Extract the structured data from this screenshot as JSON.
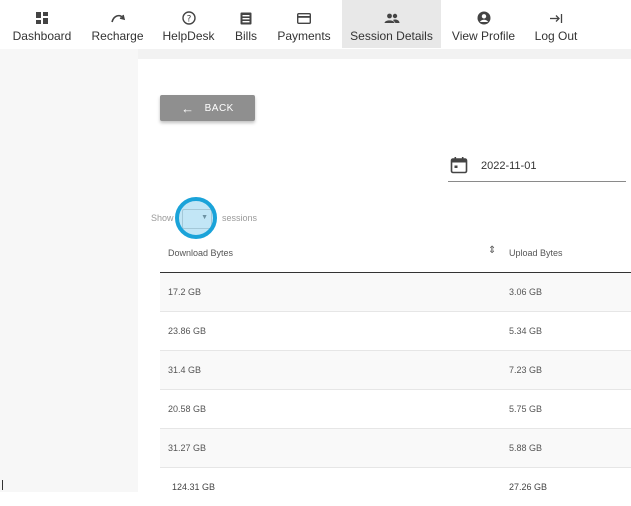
{
  "nav": {
    "items": [
      {
        "label": "Dashboard",
        "icon": "dashboard-icon"
      },
      {
        "label": "Recharge",
        "icon": "recharge-icon"
      },
      {
        "label": "HelpDesk",
        "icon": "help-icon"
      },
      {
        "label": "Bills",
        "icon": "bills-icon"
      },
      {
        "label": "Payments",
        "icon": "payments-icon"
      },
      {
        "label": "Session Details",
        "icon": "people-icon",
        "active": true
      },
      {
        "label": "View Profile",
        "icon": "profile-icon"
      },
      {
        "label": "Log Out",
        "icon": "logout-icon"
      }
    ]
  },
  "back_button": {
    "label": "BACK",
    "icon": "arrow-left-icon"
  },
  "date_filter": {
    "value": "2022-11-01",
    "icon": "calendar-icon"
  },
  "length_control": {
    "show_label": "Show",
    "suffix_label": "sessions",
    "selected": ""
  },
  "table": {
    "columns": [
      "Download Bytes",
      "Upload Bytes"
    ],
    "rows": [
      {
        "download": "17.2 GB",
        "upload": "3.06 GB"
      },
      {
        "download": "23.86 GB",
        "upload": "5.34 GB"
      },
      {
        "download": "31.4 GB",
        "upload": "7.23 GB"
      },
      {
        "download": "20.58 GB",
        "upload": "5.75 GB"
      },
      {
        "download": "31.27 GB",
        "upload": "5.88 GB"
      }
    ],
    "totals": {
      "download": "124.31 GB",
      "upload": "27.26 GB"
    }
  },
  "colors": {
    "focus_ring": "#1aa3d9",
    "back_button": "#8f8f8f",
    "active_tab": "#e8e8e8"
  }
}
